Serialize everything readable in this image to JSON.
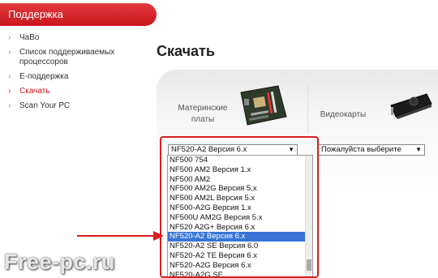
{
  "sidebar": {
    "header": "Поддержка",
    "items": [
      {
        "label": "ЧаВо",
        "active": false
      },
      {
        "label": "Список поддерживаемых процессоров",
        "active": false
      },
      {
        "label": "E-поддержка",
        "active": false
      },
      {
        "label": "Скачать",
        "active": true
      },
      {
        "label": "Scan Your PC",
        "active": false
      }
    ]
  },
  "main": {
    "title": "Скачать",
    "tabs": [
      {
        "label": "Материнские платы",
        "icon": "motherboard-icon"
      },
      {
        "label": "Видеокарты",
        "icon": "graphics-card-icon"
      }
    ],
    "product_select": {
      "value": "NF520-A2 Версия 6.x"
    },
    "gpu_select": {
      "value": "Пожалуйста выберите"
    },
    "dropdown_options": [
      "NF500 754",
      "NF500 AM2 Версия 1.x",
      "NF500 AM2",
      "NF500 AM2G Версия 5.x",
      "NF500 AM2L Версия 5.x",
      "NF500-A2G Версия 1.x",
      "NF500U AM2G Версия 5.x",
      "NF520 A2G+ Версия 6.x",
      "NF520-A2 Версия 6.x",
      "NF520-A2 SE Версия 6.0",
      "NF520-A2 TE Версия 6.x",
      "NF520-A2G Версия 6.x",
      "NF520-A2G SE"
    ],
    "selected_option": "NF520-A2 Версия 6.x"
  },
  "watermark": "Free-pc.ru",
  "colors": {
    "accent": "#d4161b",
    "selection": "#3875d7",
    "highlight": "#d81e1e"
  }
}
